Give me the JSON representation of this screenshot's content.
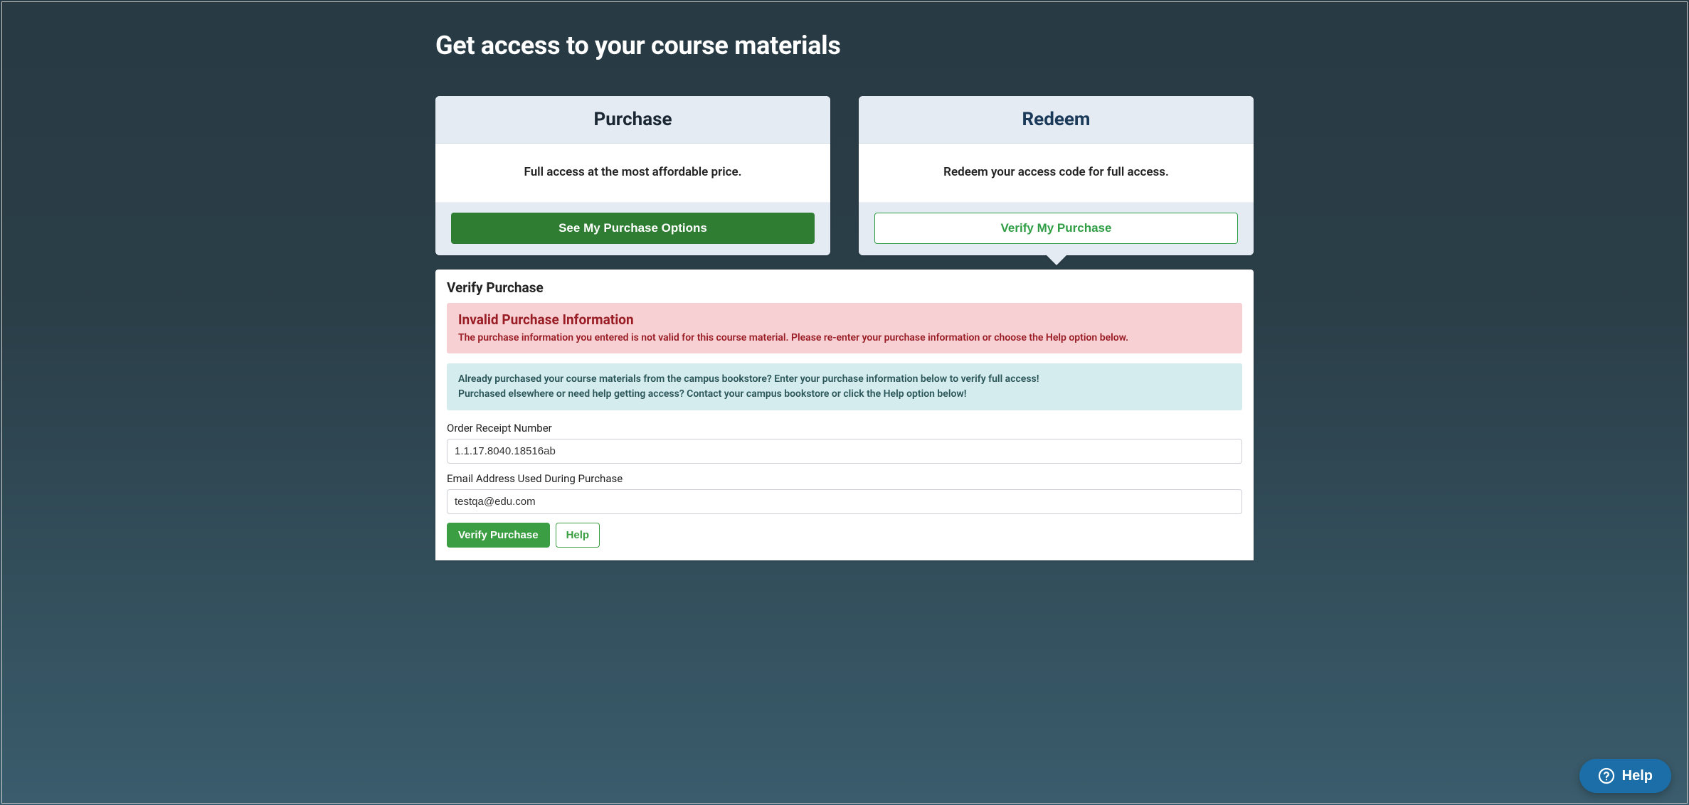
{
  "page": {
    "title": "Get access to your course materials"
  },
  "cards": {
    "purchase": {
      "title": "Purchase",
      "subtitle": "Full access at the most affordable price.",
      "button": "See My Purchase Options"
    },
    "redeem": {
      "title": "Redeem",
      "subtitle": "Redeem your access code for full access.",
      "button": "Verify My Purchase"
    }
  },
  "verify": {
    "heading": "Verify Purchase",
    "error": {
      "title": "Invalid Purchase Information",
      "text": "The purchase information you entered is not valid for this course material. Please re-enter your purchase information or choose the Help option below."
    },
    "info": {
      "line1": "Already purchased your course materials from the campus bookstore? Enter your purchase information below to verify full access!",
      "line2": "Purchased elsewhere or need help getting access? Contact your campus bookstore or click the Help option below!"
    },
    "fields": {
      "order_label": "Order Receipt Number",
      "order_value": "1.1.17.8040.18516ab",
      "email_label": "Email Address Used During Purchase",
      "email_value": "testqa@edu.com"
    },
    "buttons": {
      "verify": "Verify Purchase",
      "help": "Help"
    }
  },
  "help_widget": {
    "label": "Help"
  }
}
